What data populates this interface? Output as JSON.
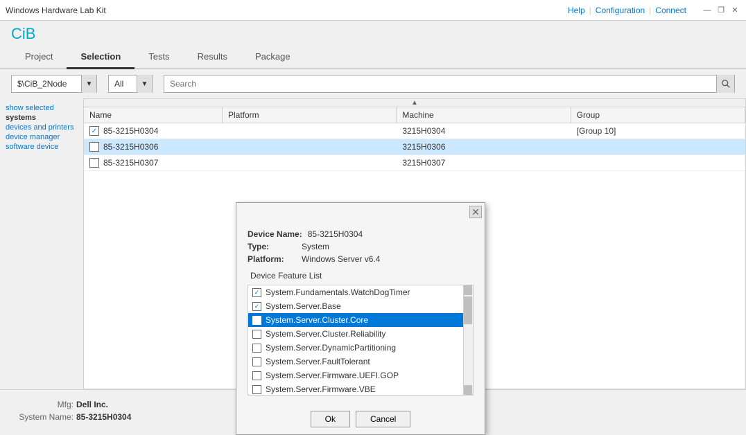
{
  "titleBar": {
    "title": "Windows Hardware Lab Kit",
    "helpLabel": "Help",
    "configLabel": "Configuration",
    "connectLabel": "Connect",
    "sep1": "|",
    "sep2": "|"
  },
  "windowControls": {
    "minimize": "—",
    "restore": "❐",
    "close": "✕"
  },
  "logo": "CiB",
  "navTabs": [
    {
      "label": "Project",
      "active": false
    },
    {
      "label": "Selection",
      "active": true
    },
    {
      "label": "Tests",
      "active": false
    },
    {
      "label": "Results",
      "active": false
    },
    {
      "label": "Package",
      "active": false
    }
  ],
  "toolbar": {
    "dropdownValue": "$\\CiB_2Node",
    "filterValue": "All",
    "searchPlaceholder": "Search"
  },
  "sidebar": {
    "links": [
      {
        "label": "show selected",
        "active": false
      },
      {
        "label": "systems",
        "active": true
      },
      {
        "label": "devices and printers",
        "active": false
      },
      {
        "label": "device manager",
        "active": false
      },
      {
        "label": "software device",
        "active": false
      }
    ]
  },
  "table": {
    "columns": [
      "Name",
      "Platform",
      "Machine",
      "Group"
    ],
    "rows": [
      {
        "name": "85-3215H0304",
        "platform": "",
        "machine": "3215H0304",
        "group": "[Group 10]",
        "checked": true,
        "selected": false
      },
      {
        "name": "85-3215H0306",
        "platform": "",
        "machine": "3215H0306",
        "group": "",
        "checked": false,
        "selected": true
      },
      {
        "name": "85-3215H0307",
        "platform": "",
        "machine": "3215H0307",
        "group": "",
        "checked": false,
        "selected": false
      }
    ]
  },
  "modal": {
    "deviceName": "85-3215H0304",
    "type": "System",
    "platform": "Windows Server v6.4",
    "featureListTitle": "Device Feature List",
    "features": [
      {
        "label": "System.Fundamentals.WatchDogTimer",
        "checked": true,
        "selected": false
      },
      {
        "label": "System.Server.Base",
        "checked": true,
        "selected": false
      },
      {
        "label": "System.Server.Cluster.Core",
        "checked": true,
        "selected": true
      },
      {
        "label": "System.Server.Cluster.Reliability",
        "checked": false,
        "selected": false
      },
      {
        "label": "System.Server.DynamicPartitioning",
        "checked": false,
        "selected": false
      },
      {
        "label": "System.Server.FaultTolerant",
        "checked": false,
        "selected": false
      },
      {
        "label": "System.Server.Firmware.UEFI.GOP",
        "checked": false,
        "selected": false
      },
      {
        "label": "System.Server.Firmware.VBE",
        "checked": false,
        "selected": false
      }
    ],
    "okLabel": "Ok",
    "cancelLabel": "Cancel"
  },
  "statusBar": {
    "mfgLabel": "Mfg:",
    "mfgValue": "Dell Inc.",
    "systemNameLabel": "System Name:",
    "systemNameValue": "85-3215H0304"
  },
  "labels": {
    "deviceNameLabel": "Device Name:",
    "typeLabel": "Type:",
    "platformLabel": "Platform:"
  }
}
